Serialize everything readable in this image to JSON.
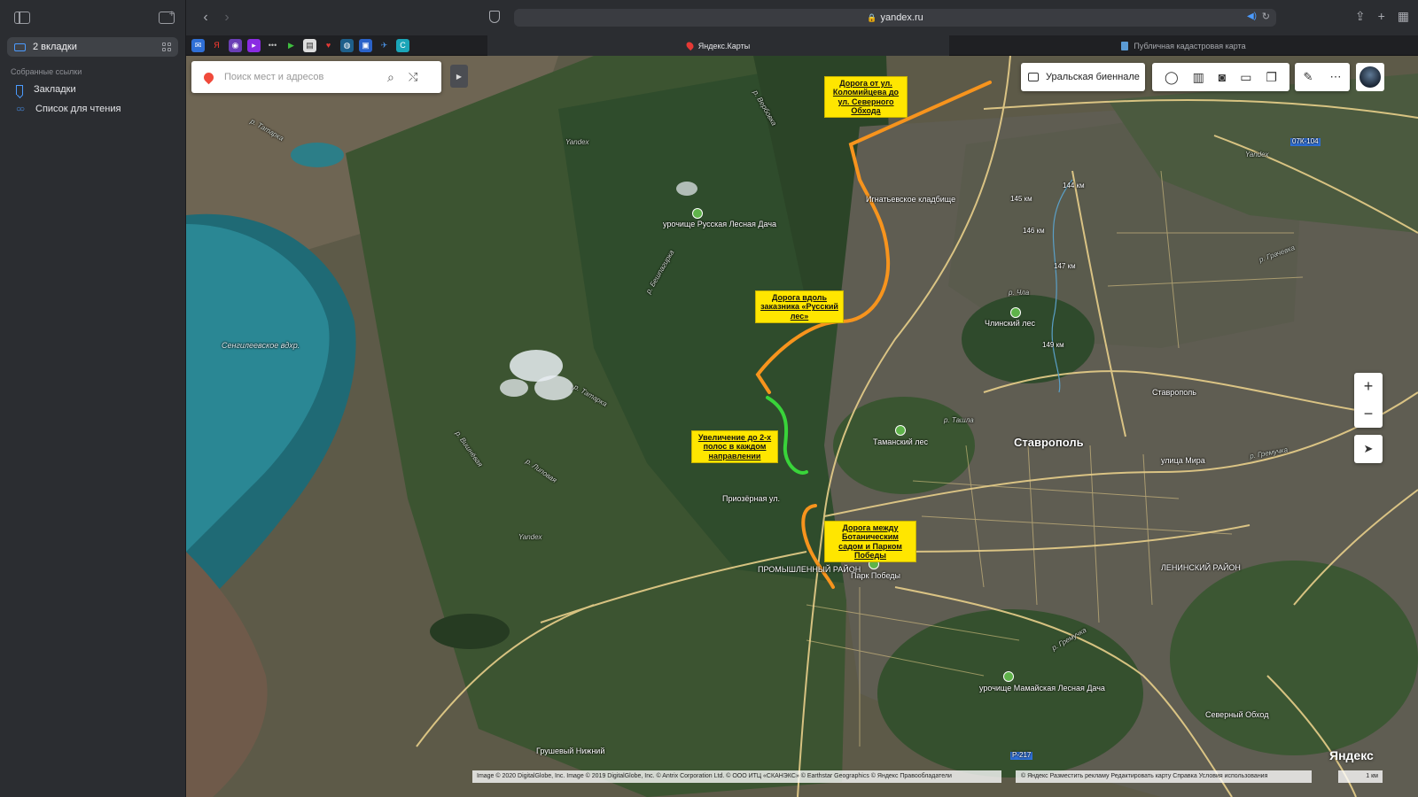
{
  "sidebar": {
    "tab_group_label": "2 вкладки",
    "section_title": "Собранные ссылки",
    "items": [
      {
        "label": "Закладки",
        "icon": "bookmark-icon"
      },
      {
        "label": "Список для чтения",
        "icon": "reading-list-icon"
      }
    ]
  },
  "toolbar": {
    "url": "yandex.ru"
  },
  "tabs": [
    {
      "label": "Яндекс.Карты",
      "active": true
    },
    {
      "label": "Публичная кадастровая карта",
      "active": false
    }
  ],
  "map": {
    "search_placeholder": "Поиск мест и адресов",
    "promo_label": "Уральская биеннале",
    "annotations": [
      {
        "text": "Дорога от ул. Коломийцева до ул. Северного Обхода",
        "color": "#ffe600"
      },
      {
        "text": "Дорога вдоль заказника «Русский лес»",
        "color": "#ffe600"
      },
      {
        "text": "Увеличение до 2-х полос в каждом направлении",
        "color": "#ffe600"
      },
      {
        "text": "Дорога между Ботаническим садом и Парком Победы",
        "color": "#ffe600"
      }
    ],
    "route_colors": {
      "new_road": "#f7941d",
      "widening": "#39d43a"
    },
    "places": {
      "city": "Ставрополь",
      "reservoir": "Сенгилеевское вдхр.",
      "russian_forest": "урочище Русская Лесная Дача",
      "chlinsky": "Члинский лес",
      "taman": "Таманский лес",
      "cemetery": "Игнатьевское кладбище",
      "stavropol_small": "Ставрополь",
      "promyshlenny": "ПРОМЫШЛЕННЫЙ РАЙОН",
      "leninsky": "ЛЕНИНСКИЙ РАЙОН",
      "victory_park": "Парк Победы",
      "mamaiskaya": "урочище Мамайская Лесная Дача",
      "grushevy": "Грушевый Нижний",
      "north_bypass": "Северный Обход",
      "ulitsa_mira": "улица Мира",
      "priozernaya": "Приозёрная ул.",
      "yandex_wm1": "Yandex",
      "yandex_wm2": "Yandex",
      "yandex_wm3": "Yandex"
    },
    "rivers": [
      "р. Татарка",
      "р. Вербовка",
      "р. Чла",
      "р. Ташла",
      "р. Татарка",
      "р. Липовая",
      "р. Вишнёвая",
      "р. Гремучка",
      "р. Бешпагирка",
      "р. Грачевка",
      "р. Гремучка"
    ],
    "road_badges": [
      "07К-104",
      "Р-217"
    ],
    "km_markers": [
      "144 км",
      "145 км",
      "146 км",
      "147 км",
      "149 км"
    ],
    "zoom_in": "+",
    "zoom_out": "−",
    "logo": "Яндекс",
    "copyright": "Image © 2020 DigitalGlobe, Inc. Image © 2019 DigitalGlobe, Inc. © Antrix Corporation Ltd. © ООО ИТЦ «СКАНЭКС» © Earthstar Geographics © Яндекс Правообладатели",
    "footer_links": "© Яндекс  Разместить рекламу  Редактировать карту  Справка  Условия использования",
    "scale_label": "1 км"
  }
}
